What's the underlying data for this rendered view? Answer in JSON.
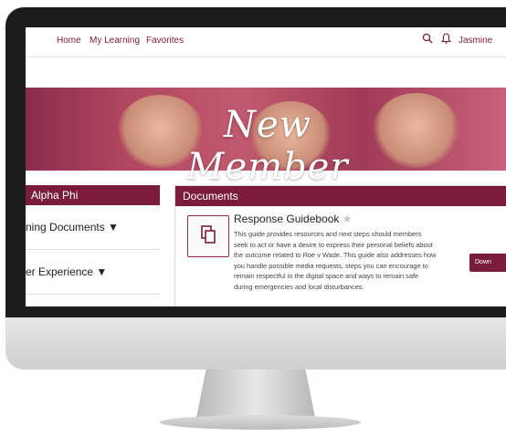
{
  "nav": {
    "links": [
      "Home",
      "My Learning",
      "Favorites"
    ],
    "search_icon": "search-icon",
    "bell_icon": "bell-icon",
    "user_name": "Jasmine"
  },
  "banner": {
    "title": "New Member"
  },
  "sidebar": {
    "header": "Alpha Phi",
    "items": [
      {
        "label": "ning Documents ▼"
      },
      {
        "label": "er Experience ▼"
      }
    ]
  },
  "documents": {
    "header": "Documents",
    "item": {
      "title": "Response Guidebook",
      "star_icon": "star-icon",
      "description": "This guide provides resources and next steps should members seek to act or have a desire to express their personal beliefs about the outcome related to Roe v Wade. This guide also addresses how you handle possible media requests, steps you can encourage to remain respectful in the digital space and ways to remain safe during emergencies and local disturbances.",
      "download_label": "Down"
    }
  },
  "colors": {
    "brand": "#7b1c3d",
    "bezel": "#1c1c1c"
  }
}
